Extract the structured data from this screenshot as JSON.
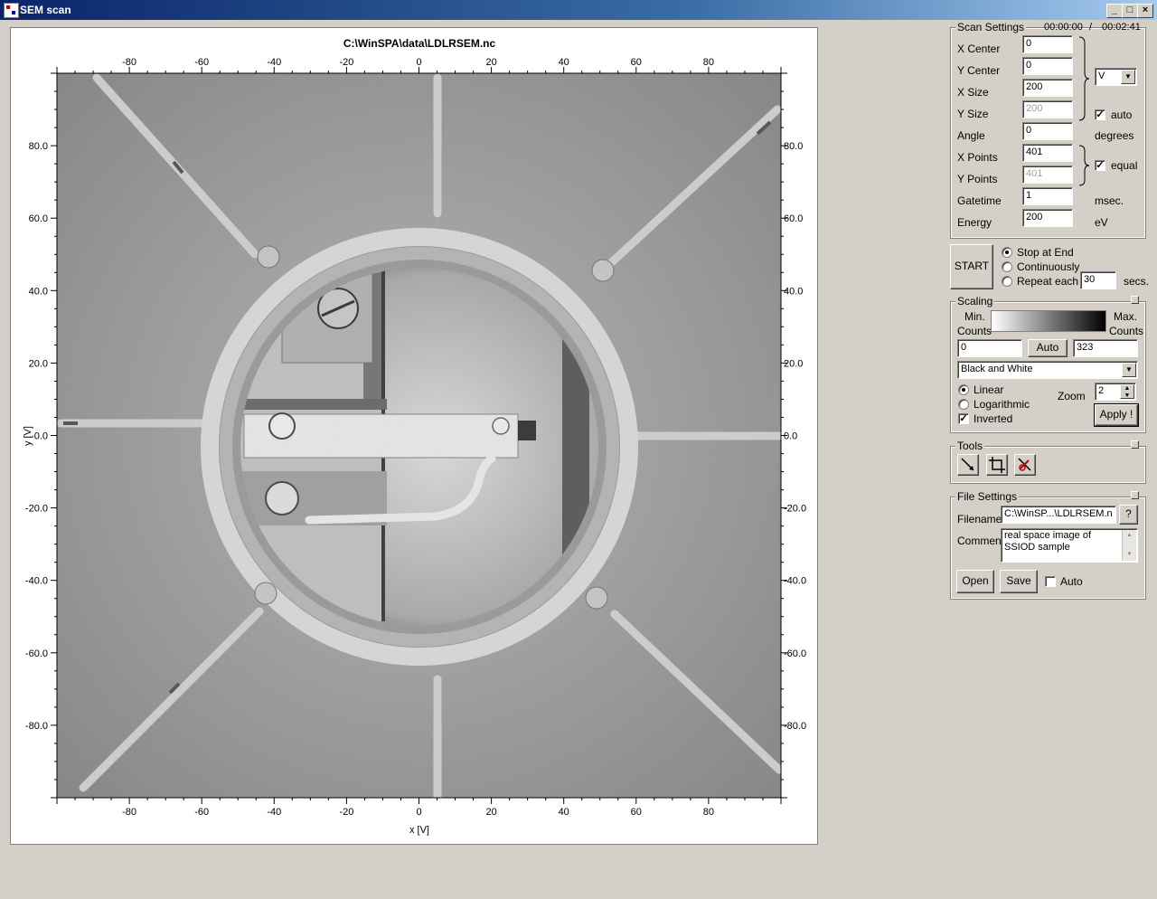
{
  "window": {
    "title": "SEM scan",
    "minimize": "_",
    "maximize": "□",
    "close": "×"
  },
  "plot": {
    "title": "C:\\WinSPA\\data\\LDLRSEM.nc",
    "xlabel": "x [V]",
    "ylabel": "y [V]",
    "x_ticks": [
      "-80",
      "-60",
      "-40",
      "-20",
      "0",
      "20",
      "40",
      "60",
      "80"
    ],
    "y_ticks": [
      "80.0",
      "60.0",
      "40.0",
      "20.0",
      "0.0",
      "-20.0",
      "-40.0",
      "-60.0",
      "-80.0"
    ]
  },
  "scan_settings": {
    "title": "Scan Settings",
    "elapsed": "00:00:00",
    "separator": "/",
    "total": "00:02:41",
    "fields": [
      {
        "label": "X Center",
        "value": "0",
        "disabled": false
      },
      {
        "label": "Y Center",
        "value": "0",
        "disabled": false
      },
      {
        "label": "X Size",
        "value": "200",
        "disabled": false
      },
      {
        "label": "Y Size",
        "value": "200",
        "disabled": true
      },
      {
        "label": "Angle",
        "value": "0",
        "disabled": false
      },
      {
        "label": "X Points",
        "value": "401",
        "disabled": false
      },
      {
        "label": "Y Points",
        "value": "401",
        "disabled": true
      },
      {
        "label": "Gatetime",
        "value": "1",
        "disabled": false
      },
      {
        "label": "Energy",
        "value": "200",
        "disabled": false
      }
    ],
    "unit_select": "V",
    "auto_label": "auto",
    "auto_checked": true,
    "degrees_label": "degrees",
    "equal_label": "equal",
    "equal_checked": true,
    "msec_label": "msec.",
    "ev_label": "eV"
  },
  "run": {
    "start_label": "START",
    "options": [
      {
        "label": "Stop at End",
        "selected": true
      },
      {
        "label": "Continuously",
        "selected": false
      },
      {
        "label": "Repeat each",
        "selected": false
      }
    ],
    "repeat_value": "30",
    "secs_label": "secs."
  },
  "scaling": {
    "title": "Scaling",
    "min_label_1": "Min.",
    "min_label_2": "Counts",
    "max_label_1": "Max.",
    "max_label_2": "Counts",
    "min_value": "0",
    "auto_label": "Auto",
    "max_value": "323",
    "colormap": "Black and White",
    "scale_options": [
      {
        "label": "Linear",
        "selected": true
      },
      {
        "label": "Logarithmic",
        "selected": false
      }
    ],
    "inverted_label": "Inverted",
    "inverted_checked": true,
    "zoom_label": "Zoom",
    "zoom_value": "2",
    "apply_label": "Apply !"
  },
  "tools": {
    "title": "Tools",
    "items": [
      "line-tool-icon",
      "crop-tool-icon",
      "delete-tool-icon"
    ]
  },
  "file_settings": {
    "title": "File Settings",
    "filename_label": "Filename",
    "filename_value": "C:\\WinSP...\\LDLRSEM.n",
    "help_label": "?",
    "comment_label": "Comment",
    "comment_value": "real space image of SSIOD sample",
    "open_label": "Open",
    "save_label": "Save",
    "auto_label": "Auto",
    "auto_checked": false
  }
}
